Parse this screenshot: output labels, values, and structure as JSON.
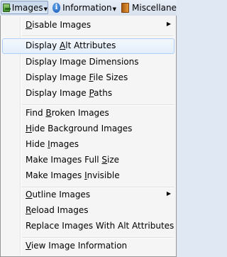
{
  "toolbar": {
    "images_label": "Images",
    "images_icon": "images-icon",
    "information_label": "Information",
    "information_icon": "info-icon",
    "misc_label": "Miscellane",
    "misc_icon": "miscellaneous-icon"
  },
  "menu": {
    "items": [
      {
        "pre": "",
        "ul": "D",
        "post": "isable Images",
        "submenu": true
      },
      {
        "pre": "Display ",
        "ul": "A",
        "post": "lt Attributes",
        "highlighted": true
      },
      {
        "pre": "Display Image ",
        "ul": "",
        "post": "Dimensions"
      },
      {
        "pre": "Display Image ",
        "ul": "F",
        "post": "ile Sizes"
      },
      {
        "pre": "Display Image ",
        "ul": "P",
        "post": "aths"
      },
      {
        "pre": "Find ",
        "ul": "B",
        "post": "roken Images"
      },
      {
        "pre": "",
        "ul": "H",
        "post": "ide Background Images"
      },
      {
        "pre": "Hide ",
        "ul": "I",
        "post": "mages"
      },
      {
        "pre": "Make Images Full ",
        "ul": "S",
        "post": "ize"
      },
      {
        "pre": "Make Images ",
        "ul": "I",
        "post": "nvisible"
      },
      {
        "pre": "",
        "ul": "O",
        "post": "utline Images",
        "submenu": true
      },
      {
        "pre": "",
        "ul": "R",
        "post": "eload Images"
      },
      {
        "pre": "Replace Images With Alt Attributes",
        "ul": "",
        "post": ""
      },
      {
        "pre": "",
        "ul": "V",
        "post": "iew Image Information"
      }
    ],
    "submenu_arrow": "▶"
  },
  "colors": {
    "highlight_border": "#aecff7",
    "menu_background": "#f5f5f5"
  }
}
